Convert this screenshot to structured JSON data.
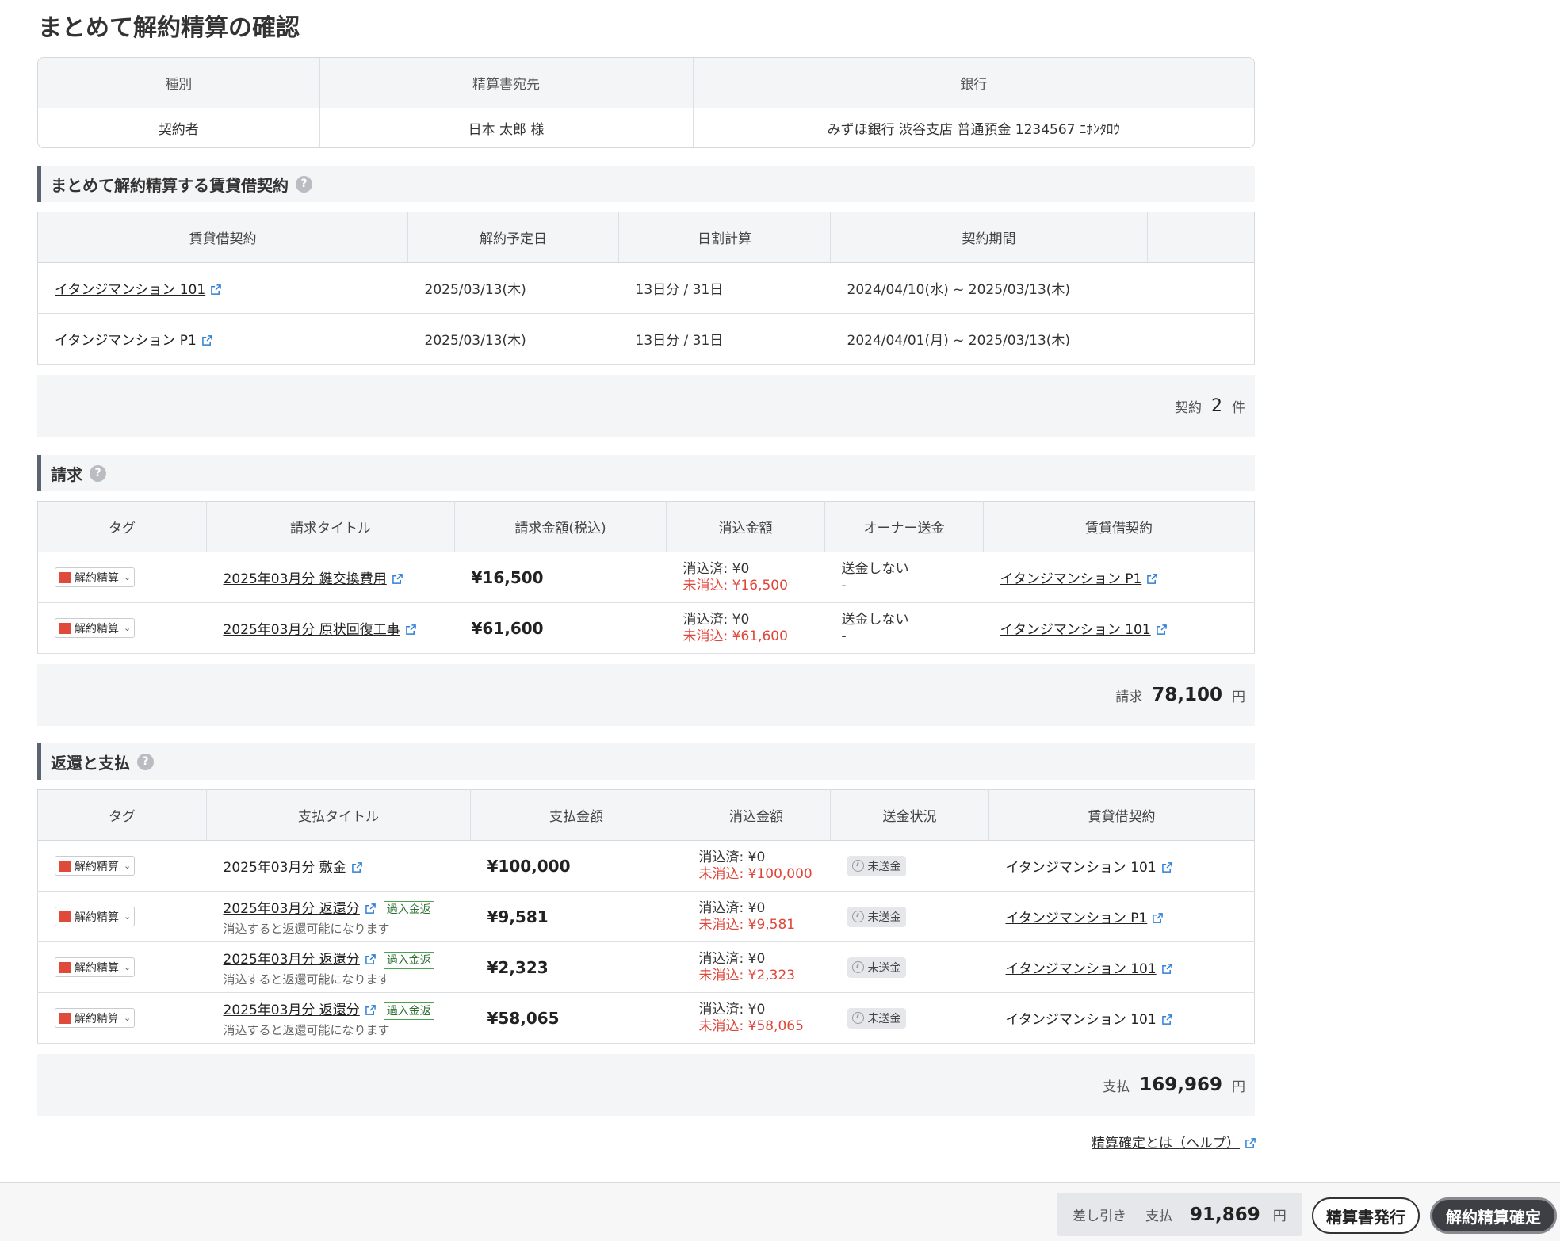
{
  "page": {
    "title": "まとめて解約精算の確認"
  },
  "summary": {
    "headers": [
      "種別",
      "精算書宛先",
      "銀行"
    ],
    "values": [
      "契約者",
      "日本 太郎 様",
      "みずほ銀行 渋谷支店 普通預金 1234567 ﾆﾎﾝﾀﾛｳ"
    ]
  },
  "contracts": {
    "title": "まとめて解約精算する賃貸借契約",
    "help": "?",
    "headers": [
      "賃貸借契約",
      "解約予定日",
      "日割計算",
      "契約期間",
      ""
    ],
    "rows": [
      {
        "name": "イタンジマンション 101",
        "date": "2025/03/13(木)",
        "prorate": "13日分 / 31日",
        "period": "2024/04/10(水) ~ 2025/03/13(木)"
      },
      {
        "name": "イタンジマンション P1",
        "date": "2025/03/13(木)",
        "prorate": "13日分 / 31日",
        "period": "2024/04/01(月) ~ 2025/03/13(木)"
      }
    ],
    "total_label": "契約",
    "total_value": "2",
    "total_unit": "件"
  },
  "billing": {
    "title": "請求",
    "help": "?",
    "headers": [
      "タグ",
      "請求タイトル",
      "請求金額(税込)",
      "消込金額",
      "オーナー送金",
      "賃貸借契約"
    ],
    "rows": [
      {
        "tag": "解約精算",
        "title": "2025年03月分 鍵交換費用",
        "amount": "¥16,500",
        "settled": "消込済: ¥0",
        "unsettled": "未消込: ¥16,500",
        "owner": "送金しない",
        "owner_sub": "-",
        "contract": "イタンジマンション P1"
      },
      {
        "tag": "解約精算",
        "title": "2025年03月分 原状回復工事",
        "amount": "¥61,600",
        "settled": "消込済: ¥0",
        "unsettled": "未消込: ¥61,600",
        "owner": "送金しない",
        "owner_sub": "-",
        "contract": "イタンジマンション 101"
      }
    ],
    "total_label": "請求",
    "total_value": "78,100",
    "total_unit": "円"
  },
  "refund": {
    "title": "返還と支払",
    "help": "?",
    "headers": [
      "タグ",
      "支払タイトル",
      "支払金額",
      "消込金額",
      "送金状況",
      "賃貸借契約"
    ],
    "rows": [
      {
        "tag": "解約精算",
        "title": "2025年03月分 敷金",
        "badge": "",
        "note": "",
        "amount": "¥100,000",
        "settled": "消込済: ¥0",
        "unsettled": "未消込: ¥100,000",
        "status": "未送金",
        "contract": "イタンジマンション 101"
      },
      {
        "tag": "解約精算",
        "title": "2025年03月分 返還分",
        "badge": "過入金返",
        "note": "消込すると返還可能になります",
        "amount": "¥9,581",
        "settled": "消込済: ¥0",
        "unsettled": "未消込: ¥9,581",
        "status": "未送金",
        "contract": "イタンジマンション P1"
      },
      {
        "tag": "解約精算",
        "title": "2025年03月分 返還分",
        "badge": "過入金返",
        "note": "消込すると返還可能になります",
        "amount": "¥2,323",
        "settled": "消込済: ¥0",
        "unsettled": "未消込: ¥2,323",
        "status": "未送金",
        "contract": "イタンジマンション 101"
      },
      {
        "tag": "解約精算",
        "title": "2025年03月分 返還分",
        "badge": "過入金返",
        "note": "消込すると返還可能になります",
        "amount": "¥58,065",
        "settled": "消込済: ¥0",
        "unsettled": "未消込: ¥58,065",
        "status": "未送金",
        "contract": "イタンジマンション 101"
      }
    ],
    "total_label": "支払",
    "total_value": "169,969",
    "total_unit": "円"
  },
  "help_link": "精算確定とは（ヘルプ）",
  "footer": {
    "diff_label": "差し引き",
    "diff_type": "支払",
    "diff_value": "91,869",
    "diff_unit": "円",
    "issue_button": "精算書発行",
    "confirm_button": "解約精算確定"
  },
  "colors": {
    "accent_red": "#e0453a",
    "tag_red": "#e04a3a",
    "link_blue": "#2f7fd6",
    "badge_green": "#4aa34e"
  },
  "icons": {
    "external_link": "external-link-icon",
    "help": "help-icon",
    "chevron": "chevron-down-icon",
    "clock": "clock-icon"
  }
}
